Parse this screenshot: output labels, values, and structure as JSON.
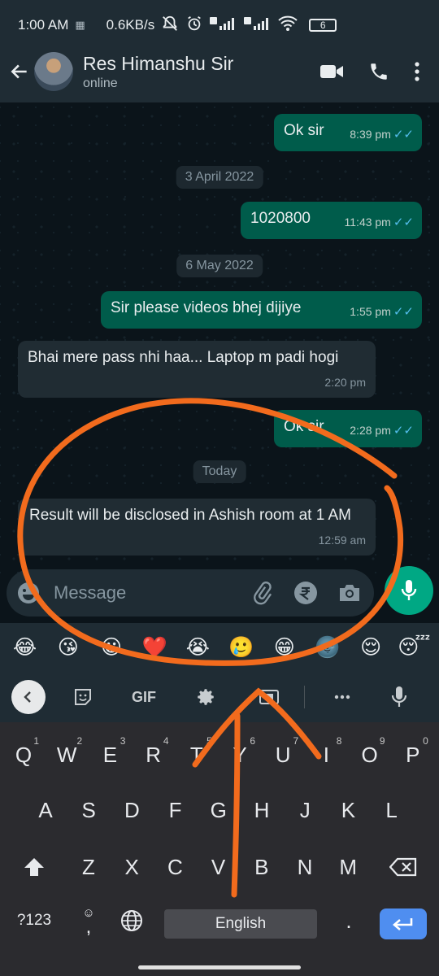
{
  "status_bar": {
    "time": "1:00 AM",
    "speed": "0.6KB/s",
    "battery": "6"
  },
  "header": {
    "contact_name": "Res Himanshu Sir",
    "presence": "online"
  },
  "messages": [
    {
      "type": "out",
      "text": "Ok sir",
      "time": "8:39 pm",
      "ticks": "✓✓"
    },
    {
      "type": "date",
      "text": "3 April 2022"
    },
    {
      "type": "out",
      "text": "1020800",
      "time": "11:43 pm",
      "ticks": "✓✓"
    },
    {
      "type": "date",
      "text": "6 May 2022"
    },
    {
      "type": "out",
      "text": "Sir please videos bhej dijiye",
      "time": "1:55 pm",
      "ticks": "✓✓"
    },
    {
      "type": "in",
      "text": "Bhai mere pass nhi haa... Laptop m padi hogi",
      "time": "2:20 pm"
    },
    {
      "type": "out",
      "text": "Ok sir",
      "time": "2:28 pm",
      "ticks": "✓✓"
    },
    {
      "type": "date",
      "text": "Today"
    },
    {
      "type": "in",
      "text": "Result will be disclosed in Ashish room at 1 AM",
      "time": "12:59 am"
    }
  ],
  "composer": {
    "placeholder": "Message"
  },
  "emoji_suggestions": [
    "😂",
    "😘",
    "😀",
    "❤️",
    "😭",
    "🥲",
    "😁",
    "🌚",
    "😌",
    "😴"
  ],
  "keyboard_toolbar": {
    "gif_label": "GIF"
  },
  "keyboard": {
    "row1": [
      {
        "k": "Q",
        "n": "1"
      },
      {
        "k": "W",
        "n": "2"
      },
      {
        "k": "E",
        "n": "3"
      },
      {
        "k": "R",
        "n": "4"
      },
      {
        "k": "T",
        "n": "5"
      },
      {
        "k": "Y",
        "n": "6"
      },
      {
        "k": "U",
        "n": "7"
      },
      {
        "k": "I",
        "n": "8"
      },
      {
        "k": "O",
        "n": "9"
      },
      {
        "k": "P",
        "n": "0"
      }
    ],
    "row2": [
      "A",
      "S",
      "D",
      "F",
      "G",
      "H",
      "J",
      "K",
      "L"
    ],
    "row3": [
      "Z",
      "X",
      "C",
      "V",
      "B",
      "N",
      "M"
    ],
    "symbols_label": "?123",
    "comma": ",",
    "period": ".",
    "space_label": "English"
  },
  "colors": {
    "outgoing_bubble": "#005c4b",
    "incoming_bubble": "#202c33",
    "accent_green": "#00a884",
    "annotation": "#f26b1d"
  }
}
